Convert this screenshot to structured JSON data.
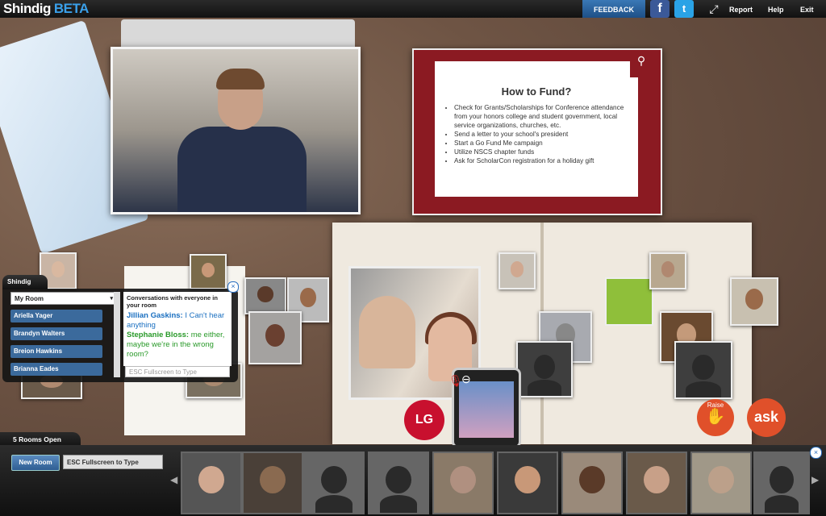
{
  "app": {
    "name": "Shindig",
    "badge": "BETA"
  },
  "topbar": {
    "feedback": "FEEDBACK",
    "facebook_icon": "f",
    "twitter_icon": "t",
    "report": "Report",
    "help": "Help",
    "exit": "Exit"
  },
  "presentation": {
    "title": "How to Fund?",
    "bullets": [
      "Check for Grants/Scholarships for Conference attendance from your honors college and student government, local service organizations, churches, etc.",
      "Send a letter to your school's president",
      "Start a Go Fund Me campaign",
      "Utilize NSCS chapter funds",
      "Ask for ScholarCon registration for a holiday gift"
    ]
  },
  "chat": {
    "tab_label": "Shindig",
    "room_select": "My Room",
    "users": [
      "Ariella Yager",
      "Brandyn Walters",
      "Breion Hawkins",
      "Brianna Eades"
    ],
    "header": "Conversations with everyone in your room",
    "messages": [
      {
        "author": "Jillian Gaskins:",
        "text": " I Can't hear anything"
      },
      {
        "author": "Stephanie Bloss:",
        "text": " me either, maybe we're in the wrong room?"
      }
    ],
    "input_placeholder": "ESC Fullscreen to Type",
    "close_icon": "×"
  },
  "controls": {
    "raise_label": "Raise",
    "ask_label": "ask",
    "lg_label": "LG"
  },
  "bottom": {
    "rooms_open": "5 Rooms Open",
    "new_room": "New Room",
    "esc_label": "ESC Fullscreen to Type",
    "close_icon": "×"
  },
  "colors": {
    "accent": "#3b6a9c",
    "raise": "#e0502a",
    "topbar": "#111111"
  }
}
